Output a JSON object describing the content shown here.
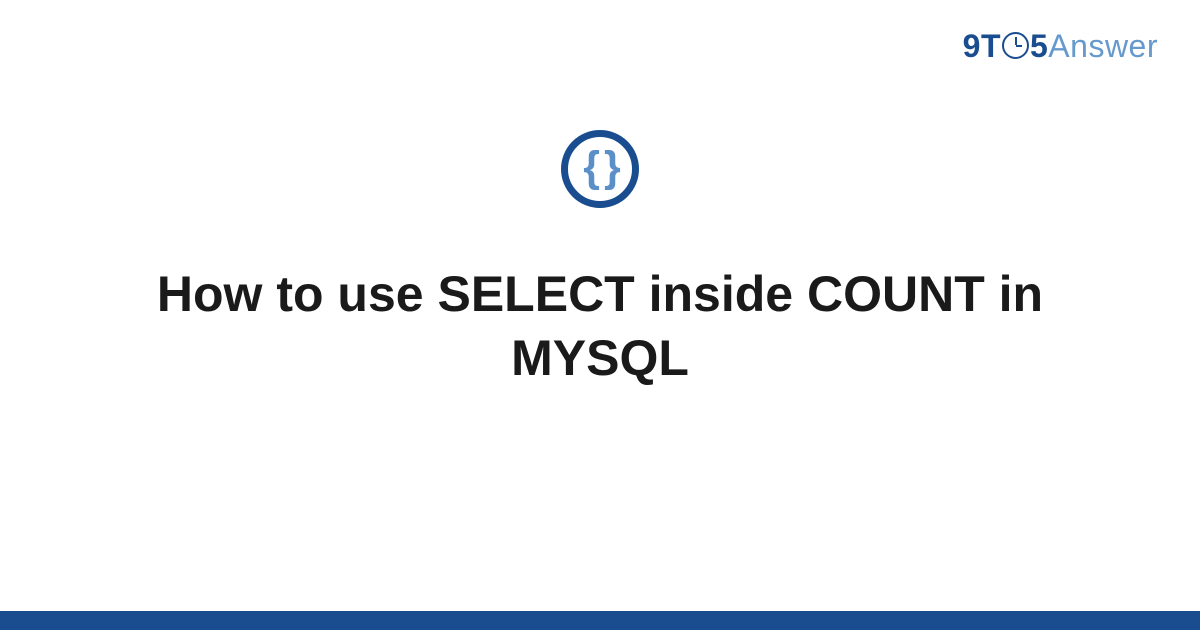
{
  "logo": {
    "part1": "9T",
    "part2": "5",
    "part3": "Answer"
  },
  "badge": {
    "symbol": "{ }"
  },
  "title": "How to use SELECT inside COUNT in MYSQL",
  "colors": {
    "primary": "#1a4d8f",
    "secondary": "#6699cc",
    "braces": "#5b8fc7"
  }
}
